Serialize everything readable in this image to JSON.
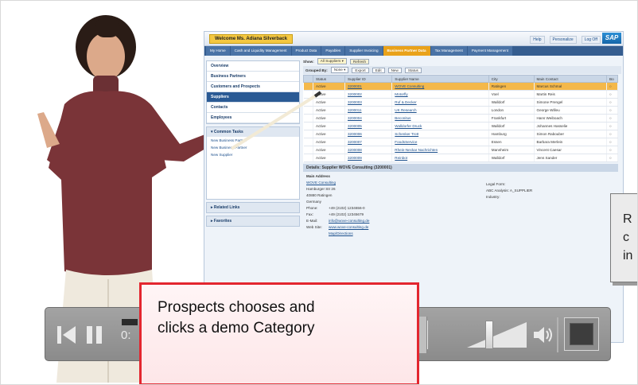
{
  "sap_portal": {
    "welcome": "Welcome Ms. Adiana Silverback",
    "top_links": [
      "Help",
      "Personalize",
      "Log Off"
    ],
    "logo": "SAP",
    "tabs": [
      "My Home",
      "Cash and Liquidity Management",
      "Product Data",
      "Payables",
      "Supplier Invoicing",
      "Business Partner Data",
      "Tax Management",
      "Payment Management"
    ],
    "active_tab_index": 5,
    "nav": [
      "Overview",
      "Business Partners",
      "Customers and Prospects",
      "Suppliers",
      "Contacts",
      "Employees"
    ],
    "selected_nav_index": 3,
    "common_tasks_header": "Common Tasks",
    "common_tasks": [
      "New Business Partner",
      "New Business Partner",
      "New Supplier"
    ],
    "related_links_header": "Related Links",
    "favorites_header": "Favorites",
    "toolbar": {
      "show_label": "Show:",
      "show_value": "All Suppliers",
      "refresh": "Refresh",
      "grouped_by_label": "Grouped By:",
      "grouped_by_value": "None",
      "buttons": [
        "Export",
        "Edit",
        "New",
        "Status"
      ]
    },
    "table": {
      "columns": [
        "Status",
        "Supplier ID",
        "Supplier Name",
        "City",
        "Main Contact",
        "Bo"
      ],
      "rows": [
        [
          "Active",
          "3200001",
          "WOVE Consulting",
          "Ratingen",
          "Marcus Schmal"
        ],
        [
          "Active",
          "3200002",
          "Motorfly",
          "Voel",
          "Martin Reis"
        ],
        [
          "Active",
          "3200003",
          "Ruf & Decker",
          "Walldorf",
          "Simone Prengel"
        ],
        [
          "Active",
          "3200011",
          "UK Research",
          "London",
          "George Willeu"
        ],
        [
          "Active",
          "3200004",
          "Beconitus",
          "Frankfurt",
          "Hans Weiboach"
        ],
        [
          "Active",
          "3200005",
          "Walldorfer Druck",
          "Walldorf",
          "Johannes Hasselie"
        ],
        [
          "Active",
          "3200006",
          "Schenker Trott",
          "Hamburg",
          "Simon Rabouber"
        ],
        [
          "Active",
          "3200007",
          "FoodsService",
          "Essen",
          "Barbara Merlein"
        ],
        [
          "Active",
          "3200008",
          "Rhein-Neckar Nachrichten",
          "Mannheim",
          "Vincent Caesar"
        ],
        [
          "Active",
          "3200009",
          "Reinbot",
          "Walldorf",
          "Jens Sander"
        ]
      ]
    },
    "details": {
      "header": "Details: Supplier WOVE Consulting (3200001)",
      "section": "Main Address",
      "company_link": "WOVE Consulting",
      "street": "Hamburger Str 26",
      "city_line": "40880 Ratingen",
      "country": "Germany",
      "phone_label": "Phone:",
      "phone": "+49 (2102) 1234656-0",
      "fax_label": "Fax:",
      "fax": "+49 (2102) 12345679",
      "email_label": "E-Mail:",
      "email": "info@wove-consulting.de",
      "web_label": "Web Site:",
      "web": "www.wove-consulting.de",
      "map": "Map/Directions",
      "legal_form": "Legal Form:",
      "abc_analysis": "ABC Analysis:",
      "abc_value": "A_SUPPLIER",
      "industry": "Industry:"
    }
  },
  "callout_main": {
    "text": "Prospects chooses and\nclicks a demo Category"
  },
  "callout_right": {
    "text": "R\nc\nin"
  },
  "player": {
    "time_partial": "0:"
  },
  "colors": {
    "callout_border": "#e3262f",
    "sap_nav_selected": "#2a5a94",
    "sap_active_tab": "#e9a21a",
    "row_highlight": "#f4b84a"
  }
}
